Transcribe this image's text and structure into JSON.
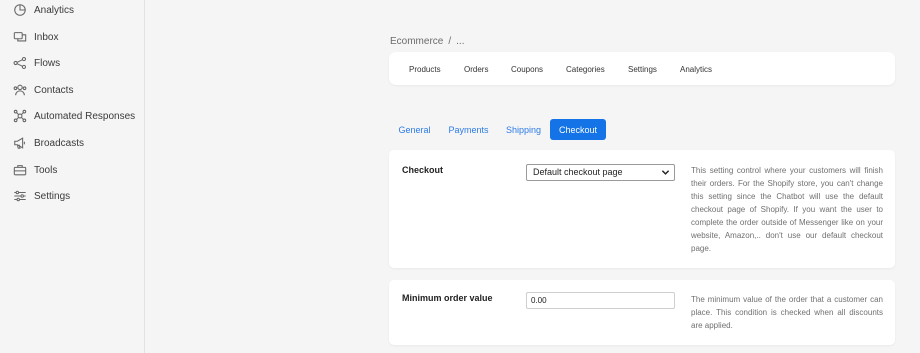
{
  "sidebar": {
    "items": [
      {
        "label": "Analytics",
        "icon": "analytics-icon"
      },
      {
        "label": "Inbox",
        "icon": "inbox-icon"
      },
      {
        "label": "Flows",
        "icon": "flows-icon"
      },
      {
        "label": "Contacts",
        "icon": "contacts-icon"
      },
      {
        "label": "Automated Responses",
        "icon": "automated-responses-icon"
      },
      {
        "label": "Broadcasts",
        "icon": "broadcasts-icon"
      },
      {
        "label": "Tools",
        "icon": "tools-icon"
      },
      {
        "label": "Settings",
        "icon": "settings-icon"
      }
    ]
  },
  "breadcrumb": {
    "root": "Ecommerce",
    "separator": "/",
    "current": "..."
  },
  "nav": {
    "links": [
      "Products",
      "Orders",
      "Coupons",
      "Categories",
      "Settings",
      "Analytics"
    ]
  },
  "tabs": [
    {
      "label": "General",
      "active": false
    },
    {
      "label": "Payments",
      "active": false
    },
    {
      "label": "Shipping",
      "active": false
    },
    {
      "label": "Checkout",
      "active": true
    }
  ],
  "checkout": {
    "title": "Checkout",
    "selected_option": "Default checkout page",
    "help": "This setting control where your customers will finish their orders. For the Shopify store, you can't change this setting since the Chatbot will use the default checkout page of Shopify. If you want the user to complete the order outside of Messenger like on your website, Amazon,.. don't use our default checkout page."
  },
  "min_order": {
    "title": "Minimum order value",
    "value": "0.00",
    "help": "The minimum value of the order that a customer can place. This condition is checked when all discounts are applied."
  },
  "colors": {
    "accent": "#1473e6",
    "tab_link": "#2d7be5",
    "background": "#f5f5f6"
  }
}
